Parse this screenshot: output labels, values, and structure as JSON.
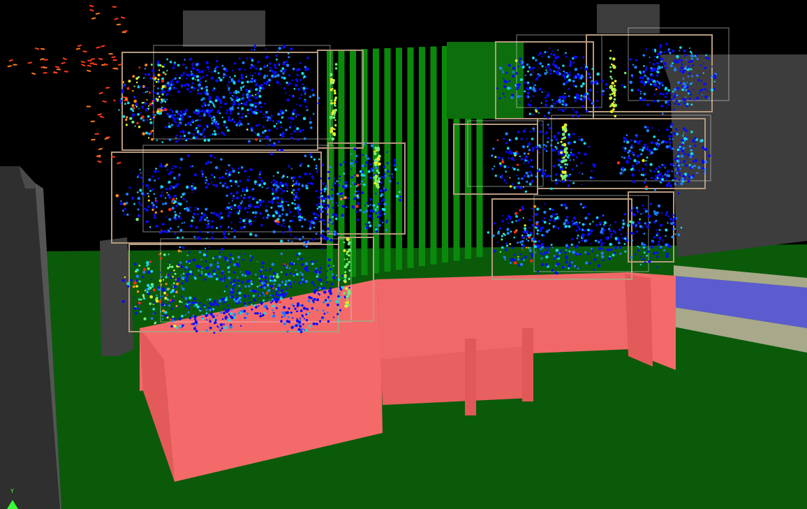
{
  "viewport": {
    "axis_gizmo": {
      "axis_y_label": "Y"
    }
  },
  "colors": {
    "background": "#000000",
    "ground": "#0a5a0a",
    "podium": "#f46a6a",
    "frame": "#b59a7e",
    "fins": "#0a8a0a",
    "neighbor_block": "#3f3f3f",
    "road": "#5c5ccf",
    "sidewalk": "#a8a88a",
    "velocity_scale": [
      "#0a0aff",
      "#1f7fff",
      "#19d8e6",
      "#6ef07a",
      "#e6ee2a",
      "#ff8a1a",
      "#ff2a1a"
    ]
  }
}
